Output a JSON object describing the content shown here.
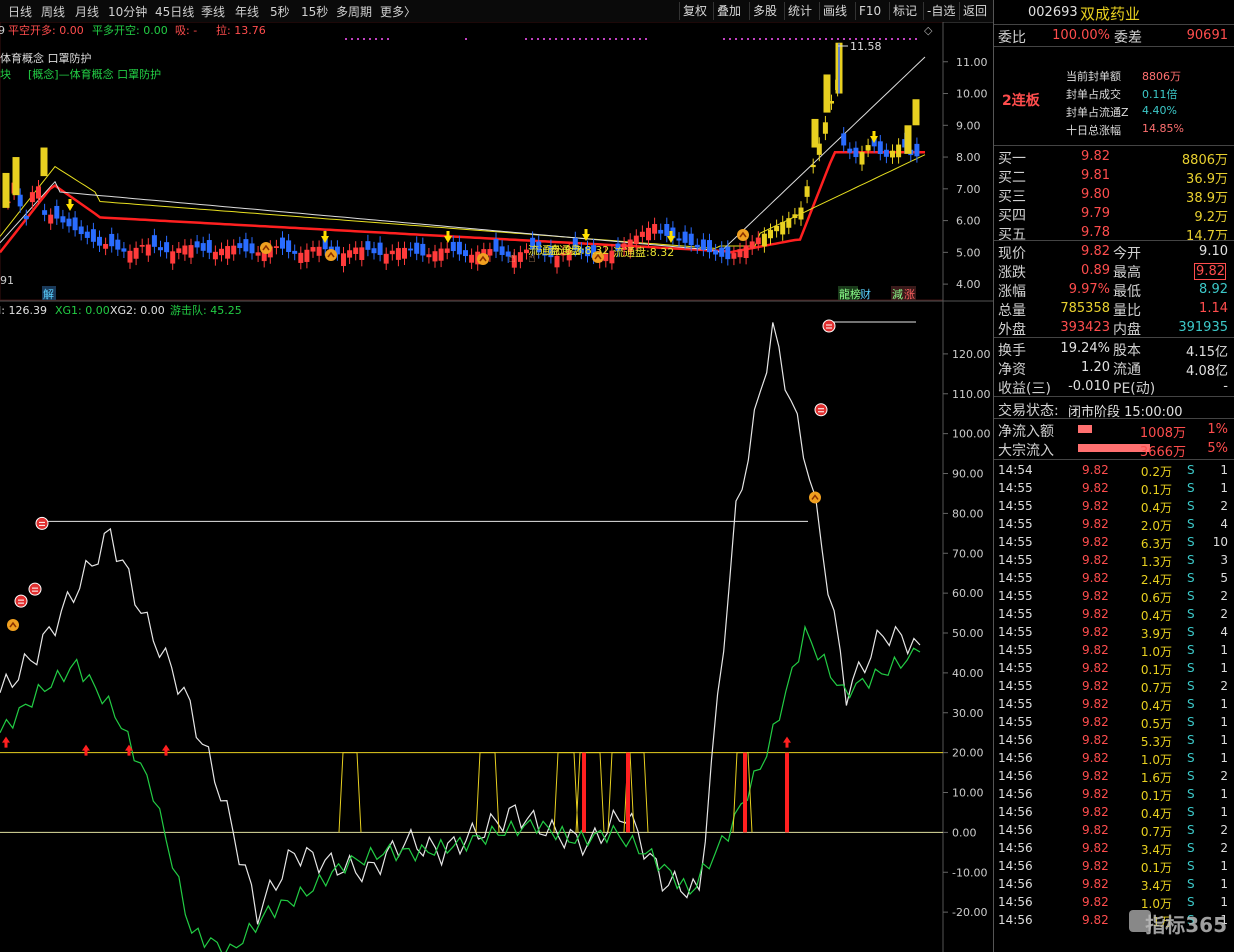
{
  "toolbar": {
    "periods": [
      "日线",
      "周线",
      "月线",
      "10分钟",
      "45日线",
      "季线",
      "年线",
      "5秒",
      "15秒",
      "多周期",
      "更多〉"
    ],
    "buttons": [
      "复权",
      "叠加",
      "多股",
      "统计",
      "画线",
      "F10",
      "标记",
      "-自选",
      "返回"
    ]
  },
  "kline": {
    "indicator_title": "平空开多: 0.00",
    "indicator_b": "平多开空: 0.00",
    "indicator_c": "吸: -",
    "indicator_d": "拉: 13.76",
    "concept_line1": "体育概念 口罩防护",
    "concept_line2a": "块",
    "concept_line2b": "[概念]—体育概念 口罩防护",
    "left_edge_value": "91",
    "left_edge_top": "9",
    "high_label": "11.58",
    "price_ticks": [
      "11.00",
      "10.00",
      "9.00",
      "8.00",
      "7.00",
      "6.00",
      "5.00",
      "4.00"
    ],
    "float_label1": "流通盘:8.3",
    "float_label2": "流通盘:8.32",
    "float_label3": "流通盘:8.32",
    "badge_jie": "解",
    "badge_lhb": "龍榜",
    "badge_cai": "财",
    "badge_jz": "減",
    "badge_zhang": "涨"
  },
  "osc": {
    "legend_a": "I: 126.39",
    "legend_b": "XG1: 0.00",
    "legend_c": "XG2: 0.00",
    "legend_d": "游击队: 45.25",
    "ticks": [
      "120.00",
      "110.00",
      "100.00",
      "90.00",
      "80.00",
      "70.00",
      "60.00",
      "50.00",
      "40.00",
      "30.00",
      "20.00",
      "10.00",
      "0.00",
      "-10.00",
      "-20.00"
    ]
  },
  "chart_data": {
    "type": "line",
    "panes": [
      {
        "name": "kline",
        "ylim": [
          3.5,
          12.0
        ],
        "recent_closes_approx": [
          4.8,
          5.0,
          5.2,
          5.5,
          6.5,
          8.0,
          8.2,
          9.5,
          11.0,
          8.4,
          8.0,
          8.1,
          8.2,
          8.8,
          9.82
        ]
      },
      {
        "name": "oscillator",
        "ylim": [
          -30,
          128
        ],
        "white_approx": [
          35,
          45,
          60,
          75,
          52,
          35,
          10,
          -20,
          -5,
          -8,
          -10,
          -2,
          -5,
          0,
          5,
          0,
          -3,
          5,
          -12,
          -15,
          80,
          126,
          90,
          35,
          50,
          47
        ],
        "green_approx": [
          25,
          35,
          42,
          30,
          10,
          -25,
          -30,
          -20,
          -15,
          -8,
          -5,
          -5,
          -3,
          0,
          2,
          -2,
          0,
          -6,
          -15,
          0,
          20,
          50,
          35,
          40,
          45.25
        ]
      }
    ],
    "reference_lines": [
      20,
      0
    ]
  },
  "panel": {
    "code": "002693",
    "name": "双成药业",
    "wb_label": "委比",
    "wb_value": "100.00%",
    "wc_label": "委差",
    "wc_value": "90691",
    "limit_tag": "2连板",
    "seal_rows": [
      {
        "k": "当前封单额",
        "v": "8806万"
      },
      {
        "k": "封单占成交",
        "v": "0.11倍"
      },
      {
        "k": "封单占流通Z",
        "v": "4.40%"
      },
      {
        "k": "十日总涨幅",
        "v": "14.85%"
      }
    ],
    "bids": [
      {
        "k": "买一",
        "p": "9.82",
        "v": "8806万"
      },
      {
        "k": "买二",
        "p": "9.81",
        "v": "36.9万"
      },
      {
        "k": "买三",
        "p": "9.80",
        "v": "38.9万"
      },
      {
        "k": "买四",
        "p": "9.79",
        "v": "9.2万"
      },
      {
        "k": "买五",
        "p": "9.78",
        "v": "14.7万"
      }
    ],
    "quote": [
      {
        "k1": "现价",
        "v1": "9.82",
        "k2": "今开",
        "v2": "9.10"
      },
      {
        "k1": "涨跌",
        "v1": "0.89",
        "k2": "最高",
        "v2": "9.82"
      },
      {
        "k1": "涨幅",
        "v1": "9.97%",
        "k2": "最低",
        "v2": "8.92"
      },
      {
        "k1": "总量",
        "v1": "785358",
        "k2": "量比",
        "v2": "1.14"
      },
      {
        "k1": "外盘",
        "v1": "393423",
        "k2": "内盘",
        "v2": "391935"
      }
    ],
    "fund": [
      {
        "k1": "换手",
        "v1": "19.24%",
        "k2": "股本",
        "v2": "4.15亿"
      },
      {
        "k1": "净资",
        "v1": "1.20",
        "k2": "流通",
        "v2": "4.08亿"
      },
      {
        "k1": "收益(三)",
        "v1": "-0.010",
        "k2": "PE(动)",
        "v2": "-"
      }
    ],
    "status_label": "交易状态:",
    "status_value": "闭市阶段 15:00:00",
    "flows": [
      {
        "k": "净流入额",
        "v": "1008万",
        "pct": "1%",
        "bar": 0.2
      },
      {
        "k": "大宗流入",
        "v": "3666万",
        "pct": "5%",
        "bar": 1.0
      }
    ],
    "ticks": [
      [
        "14:54",
        "9.82",
        "0.2万",
        "S",
        "1"
      ],
      [
        "14:55",
        "9.82",
        "0.1万",
        "S",
        "1"
      ],
      [
        "14:55",
        "9.82",
        "0.4万",
        "S",
        "2"
      ],
      [
        "14:55",
        "9.82",
        "2.0万",
        "S",
        "4"
      ],
      [
        "14:55",
        "9.82",
        "6.3万",
        "S",
        "10"
      ],
      [
        "14:55",
        "9.82",
        "1.3万",
        "S",
        "3"
      ],
      [
        "14:55",
        "9.82",
        "2.4万",
        "S",
        "5"
      ],
      [
        "14:55",
        "9.82",
        "0.6万",
        "S",
        "2"
      ],
      [
        "14:55",
        "9.82",
        "0.4万",
        "S",
        "2"
      ],
      [
        "14:55",
        "9.82",
        "3.9万",
        "S",
        "4"
      ],
      [
        "14:55",
        "9.82",
        "1.0万",
        "S",
        "1"
      ],
      [
        "14:55",
        "9.82",
        "0.1万",
        "S",
        "1"
      ],
      [
        "14:55",
        "9.82",
        "0.7万",
        "S",
        "2"
      ],
      [
        "14:55",
        "9.82",
        "0.4万",
        "S",
        "1"
      ],
      [
        "14:55",
        "9.82",
        "0.5万",
        "S",
        "1"
      ],
      [
        "14:56",
        "9.82",
        "5.3万",
        "S",
        "1"
      ],
      [
        "14:56",
        "9.82",
        "1.0万",
        "S",
        "1"
      ],
      [
        "14:56",
        "9.82",
        "1.6万",
        "S",
        "2"
      ],
      [
        "14:56",
        "9.82",
        "0.1万",
        "S",
        "1"
      ],
      [
        "14:56",
        "9.82",
        "0.4万",
        "S",
        "1"
      ],
      [
        "14:56",
        "9.82",
        "0.7万",
        "S",
        "2"
      ],
      [
        "14:56",
        "9.82",
        "3.4万",
        "S",
        "2"
      ],
      [
        "14:56",
        "9.82",
        "0.1万",
        "S",
        "1"
      ],
      [
        "14:56",
        "9.82",
        "3.4万",
        "S",
        "1"
      ],
      [
        "14:56",
        "9.82",
        "1.0万",
        "S",
        "1"
      ],
      [
        "14:56",
        "9.82",
        "0.1万",
        "S",
        "1"
      ]
    ],
    "watermark": "指标365"
  },
  "colors": {
    "up": "#ff3b3b",
    "down": "#2a6cff",
    "yellow": "#e8d020",
    "white": "#e6e6e6",
    "green": "#22cc44",
    "grid": "#3a1010"
  }
}
